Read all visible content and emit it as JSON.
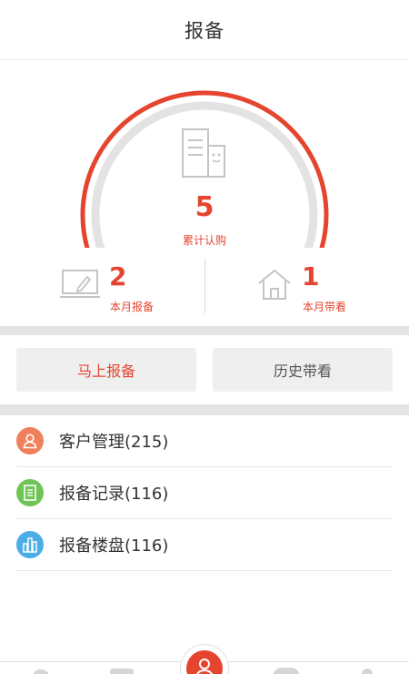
{
  "header": {
    "title": "报备"
  },
  "summary": {
    "cumulative_count": "5",
    "cumulative_label": "累计认购",
    "monthly_report_count": "2",
    "monthly_report_label": "本月报备",
    "monthly_visit_count": "1",
    "monthly_visit_label": "本月带看"
  },
  "actions": {
    "report_now": "马上报备",
    "history_visits": "历史带看"
  },
  "menu": [
    {
      "label": "客户管理(215)",
      "icon": "person-icon",
      "color": "#f0805c"
    },
    {
      "label": "报备记录(116)",
      "icon": "document-icon",
      "color": "#6fc455"
    },
    {
      "label": "报备楼盘(116)",
      "icon": "building-chart-icon",
      "color": "#4aaee6"
    }
  ],
  "colors": {
    "accent": "#e5452f",
    "gauge_track": "#e3e3e3"
  }
}
